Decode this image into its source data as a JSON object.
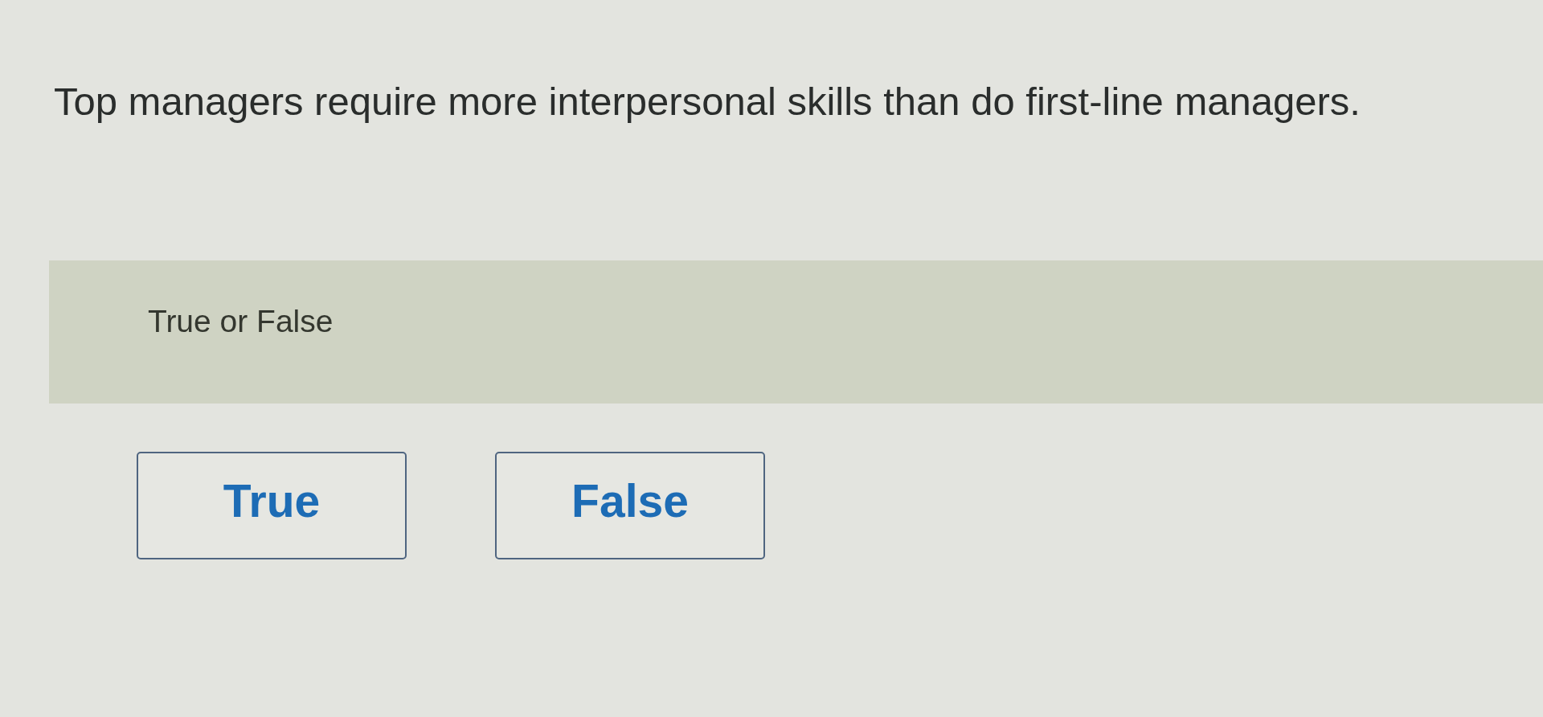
{
  "question": {
    "text": "Top managers require more interpersonal skills than do first-line managers."
  },
  "answer_panel": {
    "prompt": "True or False"
  },
  "options": [
    {
      "label": "True",
      "selected": false
    },
    {
      "label": "False",
      "selected": false
    }
  ]
}
